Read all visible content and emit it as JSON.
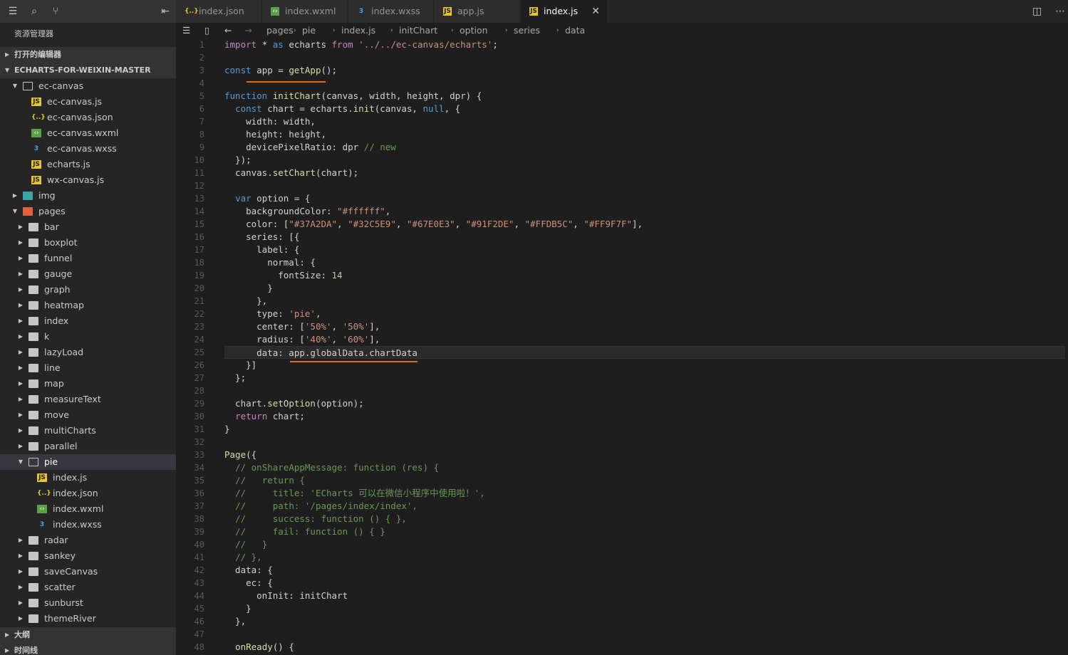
{
  "explorer_title": "资源管理器",
  "sections": {
    "open_editors": "打开的编辑器",
    "project": "ECHARTS-FOR-WEIXIN-MASTER",
    "outline": "大纲",
    "timeline": "时间线"
  },
  "tree": [
    {
      "label": "ec-canvas",
      "type": "folder-open",
      "level": 1
    },
    {
      "label": "ec-canvas.js",
      "type": "js",
      "level": 2
    },
    {
      "label": "ec-canvas.json",
      "type": "json",
      "level": 2
    },
    {
      "label": "ec-canvas.wxml",
      "type": "wxml",
      "level": 2
    },
    {
      "label": "ec-canvas.wxss",
      "type": "wxss",
      "level": 2
    },
    {
      "label": "echarts.js",
      "type": "js",
      "level": 2
    },
    {
      "label": "wx-canvas.js",
      "type": "js",
      "level": 2
    },
    {
      "label": "img",
      "type": "img",
      "level": 1
    },
    {
      "label": "pages",
      "type": "pages",
      "level": 1
    },
    {
      "label": "bar",
      "type": "folder",
      "level": 2
    },
    {
      "label": "boxplot",
      "type": "folder",
      "level": 2
    },
    {
      "label": "funnel",
      "type": "folder",
      "level": 2
    },
    {
      "label": "gauge",
      "type": "folder",
      "level": 2
    },
    {
      "label": "graph",
      "type": "folder",
      "level": 2
    },
    {
      "label": "heatmap",
      "type": "folder",
      "level": 2
    },
    {
      "label": "index",
      "type": "folder",
      "level": 2
    },
    {
      "label": "k",
      "type": "folder",
      "level": 2
    },
    {
      "label": "lazyLoad",
      "type": "folder",
      "level": 2
    },
    {
      "label": "line",
      "type": "folder",
      "level": 2
    },
    {
      "label": "map",
      "type": "folder",
      "level": 2
    },
    {
      "label": "measureText",
      "type": "folder",
      "level": 2
    },
    {
      "label": "move",
      "type": "folder",
      "level": 2
    },
    {
      "label": "multiCharts",
      "type": "folder",
      "level": 2
    },
    {
      "label": "parallel",
      "type": "folder",
      "level": 2
    },
    {
      "label": "pie",
      "type": "folder-open",
      "level": 2,
      "selected": true
    },
    {
      "label": "index.js",
      "type": "js",
      "level": 3
    },
    {
      "label": "index.json",
      "type": "json",
      "level": 3
    },
    {
      "label": "index.wxml",
      "type": "wxml",
      "level": 3
    },
    {
      "label": "index.wxss",
      "type": "wxss",
      "level": 3
    },
    {
      "label": "radar",
      "type": "folder",
      "level": 2
    },
    {
      "label": "sankey",
      "type": "folder",
      "level": 2
    },
    {
      "label": "saveCanvas",
      "type": "folder",
      "level": 2
    },
    {
      "label": "scatter",
      "type": "folder",
      "level": 2
    },
    {
      "label": "sunburst",
      "type": "folder",
      "level": 2
    },
    {
      "label": "themeRiver",
      "type": "folder",
      "level": 2
    }
  ],
  "tabs": [
    {
      "label": "index.json",
      "icon": "json"
    },
    {
      "label": "index.wxml",
      "icon": "wxml"
    },
    {
      "label": "index.wxss",
      "icon": "wxss"
    },
    {
      "label": "app.js",
      "icon": "js"
    },
    {
      "label": "index.js",
      "icon": "js",
      "active": true,
      "close": "✕"
    }
  ],
  "breadcrumb": [
    "pages",
    "pie",
    "index.js",
    "initChart",
    "option",
    "series",
    "data"
  ],
  "line_numbers": [
    "1",
    "2",
    "3",
    "4",
    "5",
    "6",
    "7",
    "8",
    "9",
    "10",
    "11",
    "12",
    "13",
    "14",
    "15",
    "16",
    "17",
    "18",
    "19",
    "20",
    "21",
    "22",
    "23",
    "24",
    "25",
    "26",
    "27",
    "28",
    "29",
    "30",
    "31",
    "32",
    "33",
    "34",
    "35",
    "36",
    "37",
    "38",
    "39",
    "40",
    "41",
    "42",
    "43",
    "44",
    "45",
    "46",
    "47",
    "48"
  ],
  "code": [
    "import * as echarts from '../../ec-canvas/echarts';",
    "",
    "const app = getApp();",
    "",
    "function initChart(canvas, width, height, dpr) {",
    "  const chart = echarts.init(canvas, null, {",
    "    width: width,",
    "    height: height,",
    "    devicePixelRatio: dpr // new",
    "  });",
    "  canvas.setChart(chart);",
    "",
    "  var option = {",
    "    backgroundColor: \"#ffffff\",",
    "    color: [\"#37A2DA\", \"#32C5E9\", \"#67E0E3\", \"#91F2DE\", \"#FFDB5C\", \"#FF9F7F\"],",
    "    series: [{",
    "      label: {",
    "        normal: {",
    "          fontSize: 14",
    "        }",
    "      },",
    "      type: 'pie',",
    "      center: ['50%', '50%'],",
    "      radius: ['40%', '60%'],",
    "      data: app.globalData.chartData",
    "    }]",
    "  };",
    "",
    "  chart.setOption(option);",
    "  return chart;",
    "}",
    "",
    "Page({",
    "  // onShareAppMessage: function (res) {",
    "  //   return {",
    "  //     title: 'ECharts 可以在微信小程序中使用啦！',",
    "  //     path: '/pages/index/index',",
    "  //     success: function () { },",
    "  //     fail: function () { }",
    "  //   }",
    "  // },",
    "  data: {",
    "    ec: {",
    "      onInit: initChart",
    "    }",
    "  },",
    "",
    "  onReady() {"
  ],
  "colors": {
    "editor_bg": "#1e1e1e",
    "sidebar_bg": "#252526",
    "accent_underline": "#e8680f",
    "string": "#ce9178",
    "comment": "#6a9955"
  }
}
